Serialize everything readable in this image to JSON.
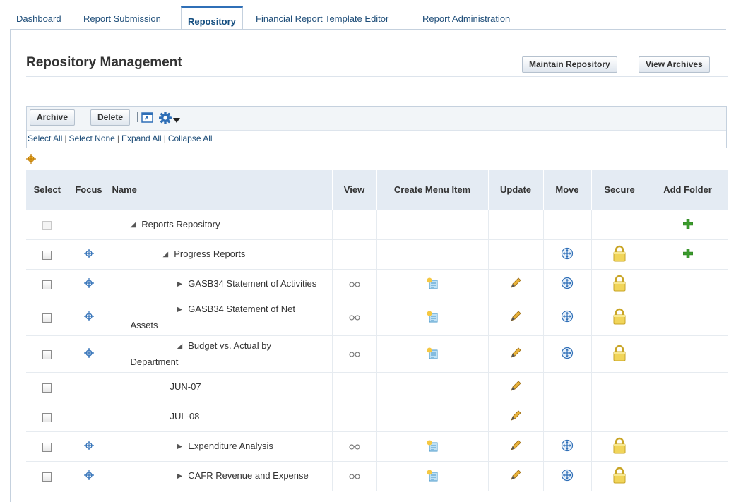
{
  "tabs": [
    {
      "label": "Dashboard",
      "active": false
    },
    {
      "label": "Report Submission",
      "active": false
    },
    {
      "label": "Repository",
      "active": true
    },
    {
      "label": "Financial Report Template Editor",
      "active": false
    },
    {
      "label": "Report Administration",
      "active": false
    }
  ],
  "page": {
    "title": "Repository Management",
    "maintain_button": "Maintain Repository",
    "archives_button": "View Archives"
  },
  "toolbar": {
    "archive_label": "Archive",
    "delete_label": "Delete",
    "icons": [
      "detach-icon",
      "gear-icon",
      "dropdown-arrow-icon"
    ],
    "select_all": "Select All",
    "select_none": "Select None",
    "expand_all": "Expand All",
    "collapse_all": "Collapse All"
  },
  "table": {
    "columns": [
      "Select",
      "Focus",
      "Name",
      "View",
      "Create Menu Item",
      "Update",
      "Move",
      "Secure",
      "Add Folder"
    ],
    "rows": [
      {
        "name": "Reports Repository",
        "name_line2": "",
        "indent": 0,
        "expander": "expanded",
        "select_enabled": false,
        "focus": false,
        "view": false,
        "create_menu": false,
        "update": false,
        "move": false,
        "secure": false,
        "add_folder": true
      },
      {
        "name": "Progress Reports",
        "name_line2": "",
        "indent": 1,
        "expander": "expanded",
        "select_enabled": true,
        "focus": true,
        "view": false,
        "create_menu": false,
        "update": false,
        "move": true,
        "secure": true,
        "add_folder": true
      },
      {
        "name": "GASB34 Statement of Activities",
        "name_line2": "",
        "indent": 2,
        "expander": "collapsed",
        "select_enabled": true,
        "focus": true,
        "view": true,
        "create_menu": true,
        "update": true,
        "move": true,
        "secure": true,
        "add_folder": false
      },
      {
        "name": "GASB34 Statement of Net",
        "name_line2": "Assets",
        "indent": 2,
        "expander": "collapsed",
        "select_enabled": true,
        "focus": true,
        "view": true,
        "create_menu": true,
        "update": true,
        "move": true,
        "secure": true,
        "add_folder": false
      },
      {
        "name": "Budget vs. Actual by",
        "name_line2": "Department",
        "indent": 2,
        "expander": "expanded",
        "select_enabled": true,
        "focus": true,
        "view": true,
        "create_menu": true,
        "update": true,
        "move": true,
        "secure": true,
        "add_folder": false
      },
      {
        "name": "JUN-07",
        "name_line2": "",
        "indent": 3,
        "expander": "none",
        "select_enabled": true,
        "focus": false,
        "view": false,
        "create_menu": false,
        "update": true,
        "move": false,
        "secure": false,
        "add_folder": false
      },
      {
        "name": "JUL-08",
        "name_line2": "",
        "indent": 3,
        "expander": "none",
        "select_enabled": true,
        "focus": false,
        "view": false,
        "create_menu": false,
        "update": true,
        "move": false,
        "secure": false,
        "add_folder": false
      },
      {
        "name": "Expenditure Analysis",
        "name_line2": "",
        "indent": 2,
        "expander": "collapsed",
        "select_enabled": true,
        "focus": true,
        "view": true,
        "create_menu": true,
        "update": true,
        "move": true,
        "secure": true,
        "add_folder": false
      },
      {
        "name": "CAFR Revenue and Expense",
        "name_line2": "",
        "indent": 2,
        "expander": "collapsed",
        "select_enabled": true,
        "focus": true,
        "view": true,
        "create_menu": true,
        "update": true,
        "move": true,
        "secure": true,
        "add_folder": false
      }
    ]
  },
  "colors": {
    "link": "#1f4e79",
    "active_tab_accent": "#2f6fb7",
    "header_bg": "#e4ebf3",
    "add_icon": "#3a9a2c",
    "lock_icon": "#e6c84a"
  }
}
